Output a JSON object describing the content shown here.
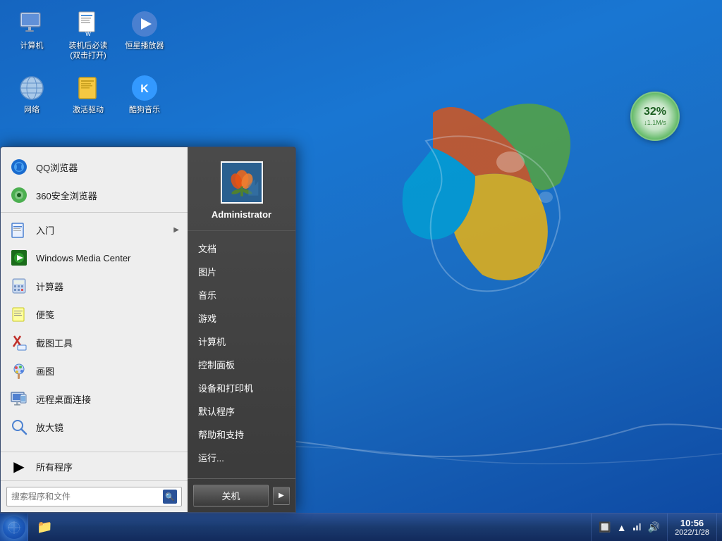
{
  "desktop": {
    "background_color": "#1565c0"
  },
  "icons": {
    "row1": [
      {
        "id": "computer",
        "label": "计算机",
        "icon": "🖥️"
      },
      {
        "id": "install-guide",
        "label": "装机后必读(双击打开)",
        "icon": "📄"
      },
      {
        "id": "media-player",
        "label": "恒星播放器",
        "icon": "▶️"
      }
    ],
    "row2": [
      {
        "id": "network",
        "label": "网络",
        "icon": "🌐"
      },
      {
        "id": "driver-cleaner",
        "label": "激活驱动",
        "icon": "📦"
      },
      {
        "id": "kkbox",
        "label": "酷狗音乐",
        "icon": "🎵"
      }
    ]
  },
  "speed_widget": {
    "percent": "32%",
    "rate": "↓1.1M/s"
  },
  "start_menu": {
    "is_open": true,
    "left_items": [
      {
        "id": "qq-browser",
        "label": "QQ浏览器",
        "icon": "🔵",
        "arrow": false
      },
      {
        "id": "360-browser",
        "label": "360安全浏览器",
        "icon": "🟢",
        "arrow": false
      },
      {
        "id": "intro",
        "label": "入门",
        "icon": "📋",
        "arrow": true
      },
      {
        "id": "wmc",
        "label": "Windows Media Center",
        "icon": "🟩",
        "arrow": false
      },
      {
        "id": "calculator",
        "label": "计算器",
        "icon": "🔢",
        "arrow": false
      },
      {
        "id": "notepad",
        "label": "便笺",
        "icon": "📝",
        "arrow": false
      },
      {
        "id": "snipping",
        "label": "截图工具",
        "icon": "✂️",
        "arrow": false
      },
      {
        "id": "paint",
        "label": "画图",
        "icon": "🎨",
        "arrow": false
      },
      {
        "id": "remote-desktop",
        "label": "远程桌面连接",
        "icon": "🖥️",
        "arrow": false
      },
      {
        "id": "magnifier",
        "label": "放大镜",
        "icon": "🔍",
        "arrow": false
      }
    ],
    "all_programs": "所有程序",
    "search_placeholder": "搜索程序和文件",
    "right_items": [
      {
        "id": "documents",
        "label": "文档"
      },
      {
        "id": "pictures",
        "label": "图片"
      },
      {
        "id": "music",
        "label": "音乐"
      },
      {
        "id": "games",
        "label": "游戏"
      },
      {
        "id": "computer-right",
        "label": "计算机"
      },
      {
        "id": "control-panel",
        "label": "控制面板"
      },
      {
        "id": "devices-printers",
        "label": "设备和打印机"
      },
      {
        "id": "default-programs",
        "label": "默认程序"
      },
      {
        "id": "help-support",
        "label": "帮助和支持"
      },
      {
        "id": "run",
        "label": "运行..."
      }
    ],
    "user": {
      "name": "Administrator",
      "avatar_alt": "user avatar"
    },
    "shutdown_label": "关机",
    "shutdown_arrow": "▶"
  },
  "taskbar": {
    "start_label": "",
    "items": [
      {
        "id": "file-explorer",
        "icon": "📁"
      }
    ],
    "clock": {
      "time": "10:56",
      "date": "2022/1/28"
    },
    "tray_icons": [
      "🔲",
      "▲",
      "🔊",
      "🌐",
      "🔊"
    ]
  }
}
